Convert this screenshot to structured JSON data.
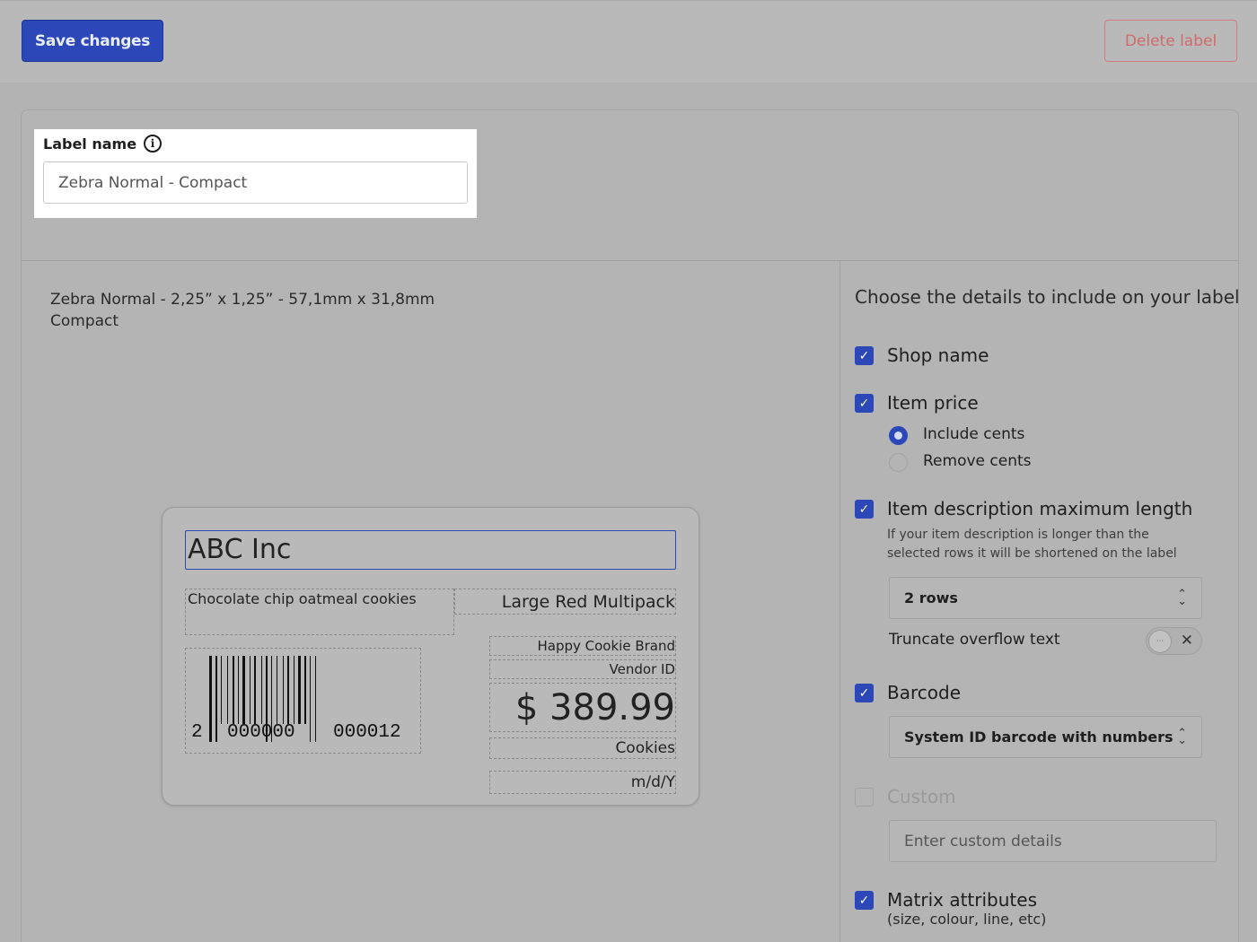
{
  "toolbar": {
    "save_label": "Save changes",
    "delete_label": "Delete label"
  },
  "label_name": {
    "title": "Label name",
    "info_icon": "i",
    "value": "Zebra Normal - Compact"
  },
  "size_info": {
    "line1": "Zebra Normal - 2,25” x 1,25” - 57,1mm x 31,8mm",
    "line2": "Compact"
  },
  "preview": {
    "shop_name": "ABC Inc",
    "description": "Chocolate chip oatmeal cookies",
    "variant": "Large Red Multipack",
    "brand": "Happy Cookie Brand",
    "vendor": "Vendor ID",
    "price": "$ 389.99",
    "category": "Cookies",
    "date": "m/d/Y",
    "barcode": {
      "prefix": "2",
      "left_group": "000000",
      "right_group": "000012"
    }
  },
  "options": {
    "title": "Choose the details to include on your label",
    "shop_name": {
      "label": "Shop name",
      "checked": true
    },
    "item_price": {
      "label": "Item price",
      "checked": true,
      "include_cents": "Include cents",
      "remove_cents": "Remove cents",
      "selected": "Include cents"
    },
    "item_description": {
      "label": "Item description maximum length",
      "checked": true,
      "hint": "If your item description is longer than the selected rows it will be shortened on the label",
      "rows_value": "2 rows",
      "truncate_label": "Truncate overflow text",
      "truncate_on": false
    },
    "barcode": {
      "label": "Barcode",
      "checked": true,
      "value": "System ID barcode with numbers"
    },
    "custom": {
      "label": "Custom",
      "checked": false,
      "placeholder": "Enter custom details"
    },
    "matrix": {
      "label": "Matrix attributes",
      "sub": "(size, colour, line, etc)",
      "checked": true
    }
  },
  "colors": {
    "accent": "#2c48b8",
    "danger": "#cf6b6b",
    "overlay": "#b3b3b3"
  }
}
